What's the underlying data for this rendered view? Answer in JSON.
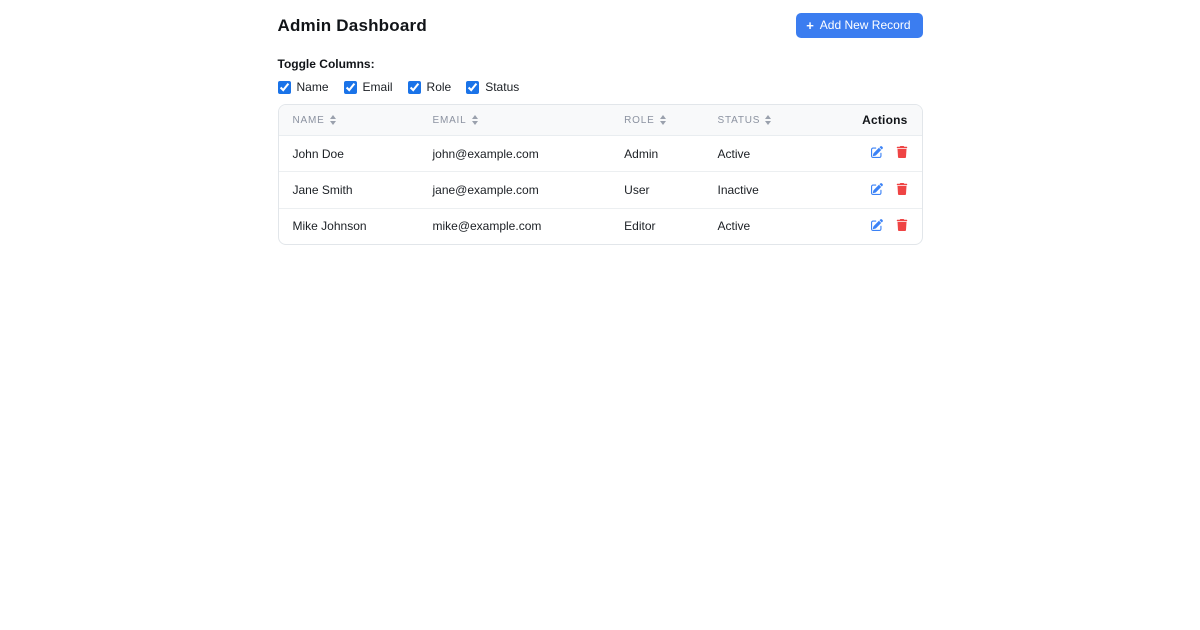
{
  "page": {
    "title": "Admin Dashboard"
  },
  "header": {
    "add_button": {
      "icon": "plus-icon",
      "plus_glyph": "+",
      "label": "Add New Record"
    }
  },
  "toggle": {
    "label": "Toggle Columns:",
    "options": [
      {
        "label": "Name",
        "checked": true
      },
      {
        "label": "Email",
        "checked": true
      },
      {
        "label": "Role",
        "checked": true
      },
      {
        "label": "Status",
        "checked": true
      }
    ]
  },
  "table": {
    "columns": [
      {
        "key": "name",
        "label": "NAME",
        "sortable": true
      },
      {
        "key": "email",
        "label": "EMAIL",
        "sortable": true
      },
      {
        "key": "role",
        "label": "ROLE",
        "sortable": true
      },
      {
        "key": "status",
        "label": "STATUS",
        "sortable": true
      },
      {
        "key": "actions",
        "label": "Actions",
        "sortable": false
      }
    ],
    "rows": [
      {
        "name": "John Doe",
        "email": "john@example.com",
        "role": "Admin",
        "status": "Active"
      },
      {
        "name": "Jane Smith",
        "email": "jane@example.com",
        "role": "User",
        "status": "Inactive"
      },
      {
        "name": "Mike Johnson",
        "email": "mike@example.com",
        "role": "Editor",
        "status": "Active"
      }
    ],
    "row_actions": [
      {
        "name": "edit",
        "icon": "edit-icon"
      },
      {
        "name": "delete",
        "icon": "trash-icon"
      }
    ]
  },
  "colors": {
    "button_blue": "#3b7df0",
    "checkbox_blue": "#1a73e8",
    "edit_icon_blue": "#3b82f6",
    "delete_icon_red": "#ef4444",
    "table_header_bg": "#f8f9fa",
    "table_border": "#e2e6ea",
    "header_text_gray": "#8b92a0"
  }
}
